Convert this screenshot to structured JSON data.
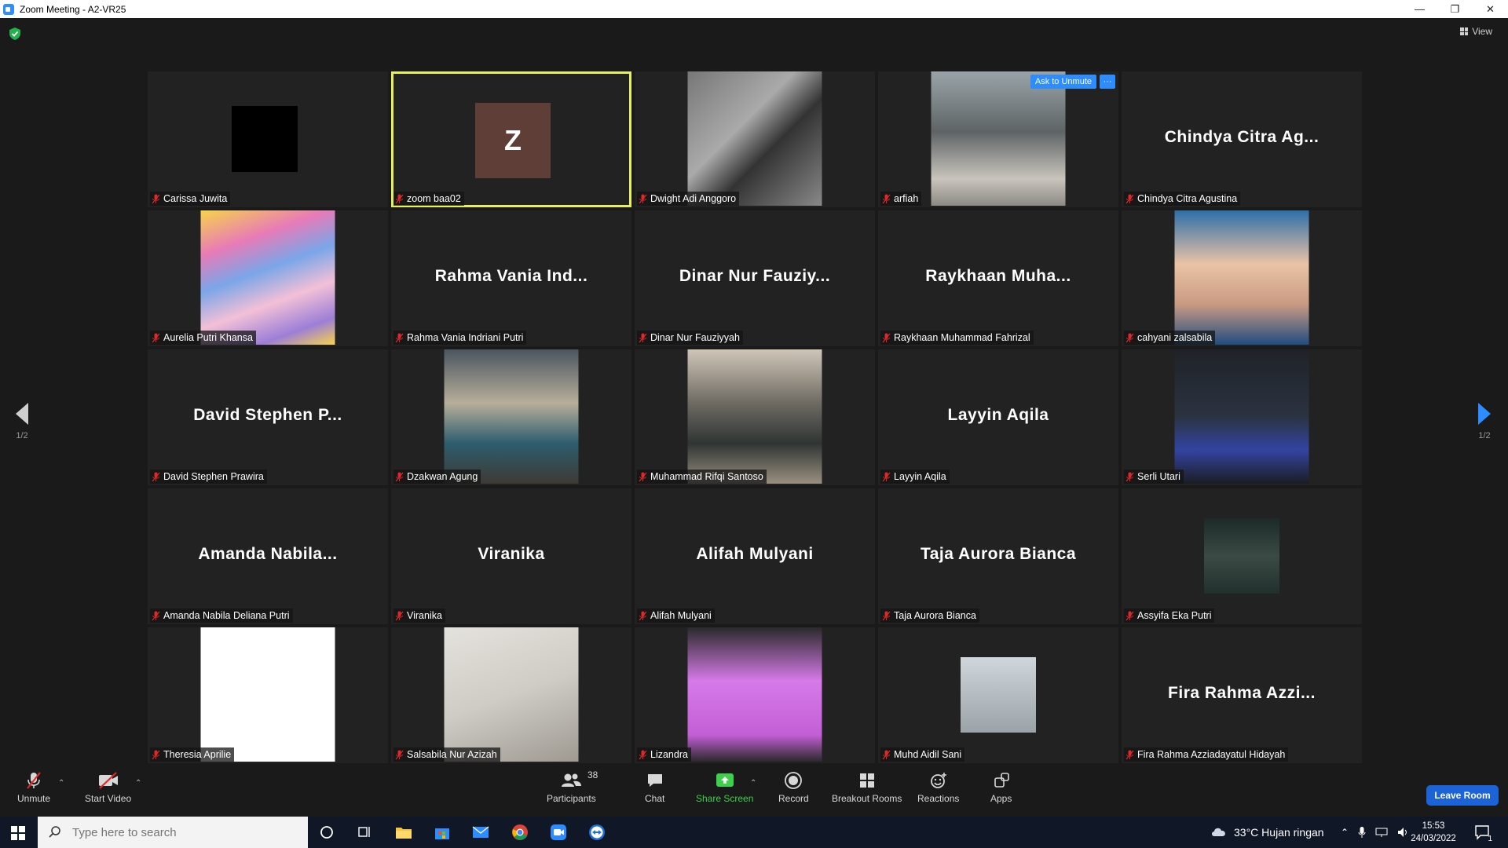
{
  "window": {
    "title": "Zoom Meeting - A2-VR25",
    "controls": [
      "—",
      "❐",
      "✕"
    ]
  },
  "meeting": {
    "view_label": "View",
    "page_left": "1/2",
    "page_right": "1/2",
    "ask_to_unmute": "Ask to Unmute",
    "more": "···",
    "avatar_letter": "Z"
  },
  "tiles": [
    {
      "name": "Carissa Juwita",
      "display": "",
      "kind": "black"
    },
    {
      "name": "zoom baa02",
      "display": "",
      "kind": "letter",
      "active": true
    },
    {
      "name": "Dwight Adi Anggoro",
      "display": "",
      "kind": "photo"
    },
    {
      "name": "arfiah",
      "display": "",
      "kind": "photo"
    },
    {
      "name": "Chindya Citra Agustina",
      "display": "Chindya Citra Ag...",
      "kind": "text"
    },
    {
      "name": "Aurelia Putri Khansa",
      "display": "",
      "kind": "photo"
    },
    {
      "name": "Rahma Vania Indriani Putri",
      "display": "Rahma Vania Ind...",
      "kind": "text"
    },
    {
      "name": "Dinar Nur Fauziyyah",
      "display": "Dinar Nur Fauziy...",
      "kind": "text"
    },
    {
      "name": "Raykhaan Muhammad Fahrizal",
      "display": "Raykhaan Muha...",
      "kind": "text"
    },
    {
      "name": "cahyani zalsabila",
      "display": "",
      "kind": "photo"
    },
    {
      "name": "David Stephen Prawira",
      "display": "David Stephen P...",
      "kind": "text"
    },
    {
      "name": "Dzakwan Agung",
      "display": "",
      "kind": "photo"
    },
    {
      "name": "Muhammad Rifqi Santoso",
      "display": "",
      "kind": "photo"
    },
    {
      "name": "Layyin Aqila",
      "display": "Layyin Aqila",
      "kind": "text"
    },
    {
      "name": "Serli Utari",
      "display": "",
      "kind": "photo"
    },
    {
      "name": "Amanda Nabila Deliana Putri",
      "display": "Amanda Nabila...",
      "kind": "text"
    },
    {
      "name": "Viranika",
      "display": "Viranika",
      "kind": "text"
    },
    {
      "name": "Alifah Mulyani",
      "display": "Alifah Mulyani",
      "kind": "text"
    },
    {
      "name": "Taja Aurora Bianca",
      "display": "Taja Aurora Bianca",
      "kind": "text"
    },
    {
      "name": "Assyifa Eka Putri",
      "display": "",
      "kind": "photo"
    },
    {
      "name": "Theresia Aprilie",
      "display": "",
      "kind": "photo"
    },
    {
      "name": "Salsabila Nur Azizah",
      "display": "",
      "kind": "photo"
    },
    {
      "name": "Lizandra",
      "display": "",
      "kind": "photo"
    },
    {
      "name": "Muhd Aidil Sani",
      "display": "",
      "kind": "photo"
    },
    {
      "name": "Fira Rahma Azziadayatul Hidayah",
      "display": "Fira Rahma Azzi...",
      "kind": "text"
    }
  ],
  "toolbar": {
    "unmute": "Unmute",
    "start_video": "Start Video",
    "participants": "Participants",
    "participants_count": "38",
    "chat": "Chat",
    "share_screen": "Share Screen",
    "record": "Record",
    "breakout_rooms": "Breakout Rooms",
    "reactions": "Reactions",
    "apps": "Apps",
    "leave_room": "Leave Room"
  },
  "taskbar": {
    "search_placeholder": "Type here to search",
    "weather": "33°C  Hujan ringan",
    "time": "15:53",
    "date": "24/03/2022",
    "notifications": "1"
  },
  "colors": {
    "accent": "#2d8cff",
    "active_speaker": "#e7f056",
    "mic_muted": "#e02828",
    "share_green": "#3dd14b",
    "leave": "#1b63d6"
  }
}
